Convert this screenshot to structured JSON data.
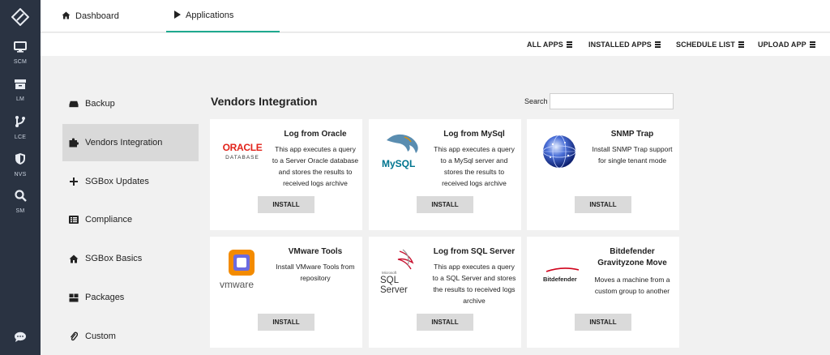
{
  "rail": {
    "items": [
      {
        "label": "SCM",
        "icon": "monitor-icon"
      },
      {
        "label": "LM",
        "icon": "archive-icon"
      },
      {
        "label": "LCE",
        "icon": "branch-icon"
      },
      {
        "label": "NVS",
        "icon": "shield-icon"
      },
      {
        "label": "SM",
        "icon": "search-icon"
      }
    ]
  },
  "tabs": {
    "dashboard": "Dashboard",
    "applications": "Applications"
  },
  "subnav": {
    "all_apps": "ALL APPS",
    "installed_apps": "INSTALLED APPS",
    "schedule_list": "SCHEDULE LIST",
    "upload_app": "UPLOAD APP"
  },
  "sidebar": {
    "items": [
      {
        "label": "Backup",
        "icon": "drive-icon"
      },
      {
        "label": "Vendors Integration",
        "icon": "puzzle-icon"
      },
      {
        "label": "SGBox Updates",
        "icon": "plus-icon"
      },
      {
        "label": "Compliance",
        "icon": "list-icon"
      },
      {
        "label": "SGBox Basics",
        "icon": "home-icon"
      },
      {
        "label": "Packages",
        "icon": "packages-icon"
      },
      {
        "label": "Custom",
        "icon": "paperclip-icon"
      }
    ]
  },
  "content": {
    "title": "Vendors Integration",
    "search_label": "Search",
    "search_value": ""
  },
  "cards": [
    {
      "title": "Log from Oracle",
      "description": "This app executes a query to a Server Oracle database and stores the results to received logs archive",
      "button": "INSTALL",
      "logo_line1": "ORACLE",
      "logo_line2": "DATABASE"
    },
    {
      "title": "Log from MySql",
      "description": "This app executes a query to a MySql server and stores the results to received logs archive",
      "button": "INSTALL",
      "logo_line1": "MySQL"
    },
    {
      "title": "SNMP Trap",
      "description": "Install SNMP Trap support for single tenant mode",
      "button": "INSTALL"
    },
    {
      "title": "VMware Tools",
      "description": "Install VMware Tools from repository",
      "button": "INSTALL",
      "logo_line1": "vmware"
    },
    {
      "title": "Log from SQL Server",
      "description": "This app executes a query to a SQL Server and stores the results to received logs archive",
      "button": "INSTALL",
      "logo_line1": "SQL Server",
      "logo_line2": "Microsoft"
    },
    {
      "title": "Bitdefender Gravityzone Move",
      "description": "Moves a machine from a custom group to another",
      "button": "INSTALL",
      "logo_line1": "Bitdefender"
    }
  ],
  "colors": {
    "rail": "#2a3342",
    "accent": "#1fa98f",
    "oracle": "#e2231a",
    "mysql_blue": "#00758f",
    "vmware_orange": "#f38b00"
  }
}
